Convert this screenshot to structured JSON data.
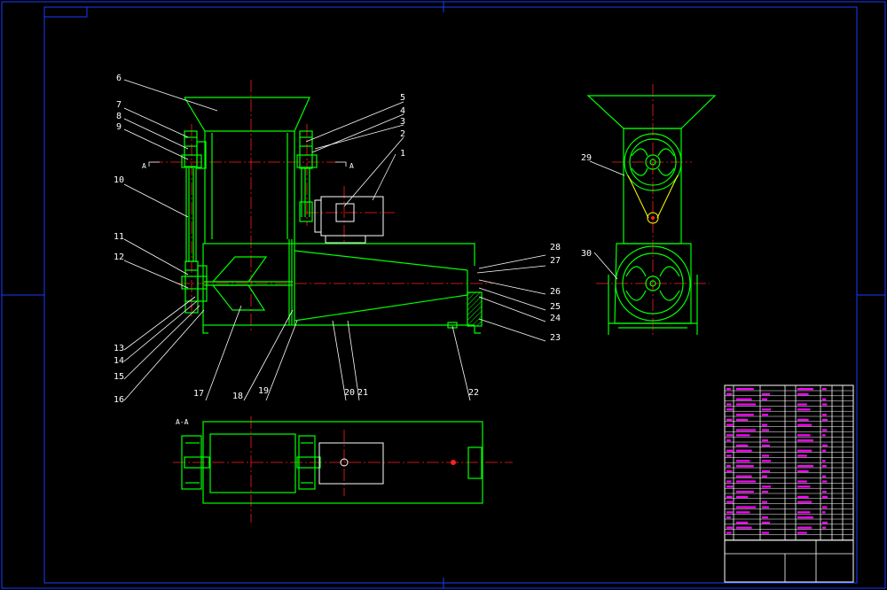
{
  "colors": {
    "background": "#000000",
    "frame": "#1a3cff",
    "part_outline": "#00ff00",
    "centerline": "#ff2020",
    "leader": "#ffffff",
    "motor": "#ffffff",
    "title_block_text": "#ff00ff"
  },
  "front_view": {
    "part_numbers": [
      "1",
      "2",
      "3",
      "4",
      "5",
      "6",
      "7",
      "8",
      "9",
      "10",
      "11",
      "12",
      "13",
      "14",
      "15",
      "16",
      "17",
      "18",
      "19",
      "20",
      "21",
      "22",
      "23",
      "24",
      "25",
      "26",
      "27",
      "28"
    ],
    "section_mark": "A"
  },
  "side_view": {
    "part_numbers": [
      "29",
      "30"
    ]
  },
  "top_view": {
    "view_label": "A-A"
  }
}
